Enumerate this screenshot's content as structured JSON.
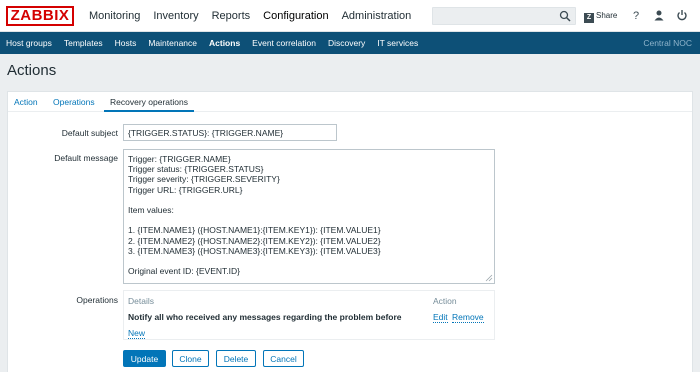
{
  "brand": {
    "logo_text": "ZABBIX",
    "color": "#d40000"
  },
  "main_nav": [
    {
      "label": "Monitoring"
    },
    {
      "label": "Inventory"
    },
    {
      "label": "Reports"
    },
    {
      "label": "Configuration",
      "active": true
    },
    {
      "label": "Administration"
    }
  ],
  "header": {
    "search": {
      "value": "",
      "placeholder": ""
    },
    "share_label": "Share",
    "icons": [
      "search-icon",
      "share-icon",
      "help-icon",
      "user-icon",
      "power-icon"
    ]
  },
  "sub_nav": {
    "items": [
      {
        "label": "Host groups"
      },
      {
        "label": "Templates"
      },
      {
        "label": "Hosts"
      },
      {
        "label": "Maintenance"
      },
      {
        "label": "Actions",
        "active": true
      },
      {
        "label": "Event correlation"
      },
      {
        "label": "Discovery"
      },
      {
        "label": "IT services"
      }
    ],
    "node_label": "Central NOC",
    "color": "#0d5077"
  },
  "page": {
    "title": "Actions"
  },
  "tabs": [
    {
      "label": "Action"
    },
    {
      "label": "Operations"
    },
    {
      "label": "Recovery operations",
      "active": true
    }
  ],
  "form": {
    "subject_label": "Default subject",
    "subject_value": "{TRIGGER.STATUS}: {TRIGGER.NAME}",
    "message_label": "Default message",
    "message_value": "Trigger: {TRIGGER.NAME}\nTrigger status: {TRIGGER.STATUS}\nTrigger severity: {TRIGGER.SEVERITY}\nTrigger URL: {TRIGGER.URL}\n\nItem values:\n\n1. {ITEM.NAME1} ({HOST.NAME1}:{ITEM.KEY1}): {ITEM.VALUE1}\n2. {ITEM.NAME2} ({HOST.NAME2}:{ITEM.KEY2}): {ITEM.VALUE2}\n3. {ITEM.NAME3} ({HOST.NAME3}:{ITEM.KEY3}): {ITEM.VALUE3}\n\nOriginal event ID: {EVENT.ID}",
    "operations_label": "Operations",
    "operations": {
      "col_details": "Details",
      "col_action": "Action",
      "rows": [
        {
          "details": "Notify all who received any messages regarding the problem before",
          "edit": "Edit",
          "remove": "Remove"
        }
      ],
      "new_label": "New"
    }
  },
  "buttons": {
    "update": "Update",
    "clone": "Clone",
    "delete": "Delete",
    "cancel": "Cancel"
  }
}
